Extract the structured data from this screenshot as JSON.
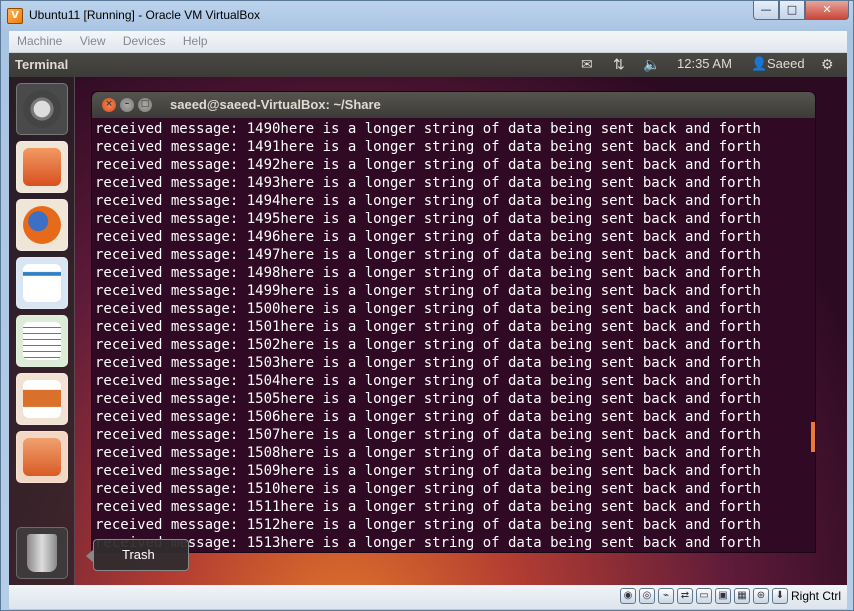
{
  "window": {
    "title": "Ubuntu11 [Running] - Oracle VM VirtualBox",
    "min": "—",
    "restore": "□",
    "close": "✕"
  },
  "menu": [
    "Machine",
    "View",
    "Devices",
    "Help"
  ],
  "panel": {
    "app": "Terminal",
    "time": "12:35 AM",
    "user": "Saeed"
  },
  "terminal": {
    "title": "saeed@saeed-VirtualBox: ~/Share",
    "lines": [
      "received message: 1490here is a longer string of data being sent back and forth",
      "received message: 1491here is a longer string of data being sent back and forth",
      "received message: 1492here is a longer string of data being sent back and forth",
      "received message: 1493here is a longer string of data being sent back and forth",
      "received message: 1494here is a longer string of data being sent back and forth",
      "received message: 1495here is a longer string of data being sent back and forth",
      "received message: 1496here is a longer string of data being sent back and forth",
      "received message: 1497here is a longer string of data being sent back and forth",
      "received message: 1498here is a longer string of data being sent back and forth",
      "received message: 1499here is a longer string of data being sent back and forth",
      "received message: 1500here is a longer string of data being sent back and forth",
      "received message: 1501here is a longer string of data being sent back and forth",
      "received message: 1502here is a longer string of data being sent back and forth",
      "received message: 1503here is a longer string of data being sent back and forth",
      "received message: 1504here is a longer string of data being sent back and forth",
      "received message: 1505here is a longer string of data being sent back and forth",
      "received message: 1506here is a longer string of data being sent back and forth",
      "received message: 1507here is a longer string of data being sent back and forth",
      "received message: 1508here is a longer string of data being sent back and forth",
      "received message: 1509here is a longer string of data being sent back and forth",
      "received message: 1510here is a longer string of data being sent back and forth",
      "received message: 1511here is a longer string of data being sent back and forth",
      "received message: 1512here is a longer string of data being sent back and forth",
      "received message: 1513here is a longer string of data being sent back and forth"
    ]
  },
  "launcher": {
    "items": [
      {
        "icon": "ubuntu-dash-icon",
        "color": "#5e5e5e"
      },
      {
        "icon": "home-folder-icon",
        "color": "#e8642c"
      },
      {
        "icon": "firefox-icon",
        "color": "#e66a1a"
      },
      {
        "icon": "libreoffice-writer-icon",
        "color": "#2f7fc4"
      },
      {
        "icon": "libreoffice-calc-icon",
        "color": "#3f9c2e"
      },
      {
        "icon": "libreoffice-impress-icon",
        "color": "#d9702c"
      },
      {
        "icon": "ubuntu-software-center-icon",
        "color": "#d95b24"
      },
      {
        "icon": "trash-icon",
        "color": "#6d6d6d"
      }
    ],
    "tooltip": "Trash"
  },
  "statusbar": {
    "host_key": "Right Ctrl"
  }
}
